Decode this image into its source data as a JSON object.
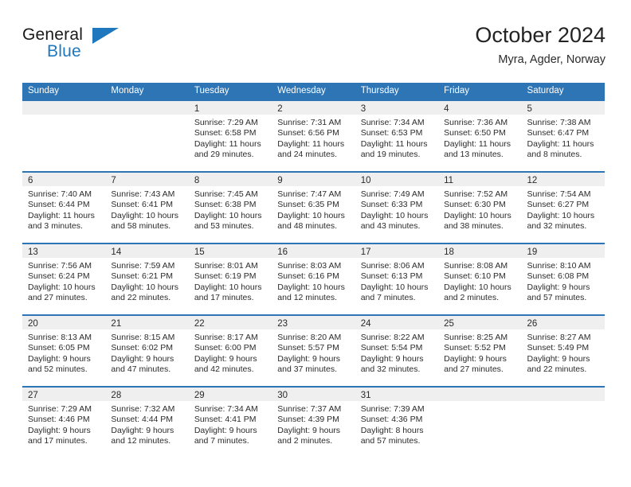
{
  "brand": {
    "word_one": "General",
    "word_two": "Blue",
    "triangle_color": "#1F77BE",
    "icon": "triangle-logo-icon"
  },
  "header": {
    "title": "October 2024",
    "subtitle": "Myra, Agder, Norway"
  },
  "theme": {
    "header_blue": "#2E75B6",
    "band_gray": "#EFEFEF",
    "text": "#2B2B2B",
    "brand_blue": "#1F77BE"
  },
  "weekdays": [
    "Sunday",
    "Monday",
    "Tuesday",
    "Wednesday",
    "Thursday",
    "Friday",
    "Saturday"
  ],
  "weeks": [
    [
      {
        "day": "",
        "empty": true,
        "sunrise": "",
        "sunset": "",
        "daylight_line1": "",
        "daylight_line2": ""
      },
      {
        "day": "",
        "empty": true,
        "sunrise": "",
        "sunset": "",
        "daylight_line1": "",
        "daylight_line2": ""
      },
      {
        "day": "1",
        "empty": false,
        "sunrise": "Sunrise: 7:29 AM",
        "sunset": "Sunset: 6:58 PM",
        "daylight_line1": "Daylight: 11 hours",
        "daylight_line2": "and 29 minutes."
      },
      {
        "day": "2",
        "empty": false,
        "sunrise": "Sunrise: 7:31 AM",
        "sunset": "Sunset: 6:56 PM",
        "daylight_line1": "Daylight: 11 hours",
        "daylight_line2": "and 24 minutes."
      },
      {
        "day": "3",
        "empty": false,
        "sunrise": "Sunrise: 7:34 AM",
        "sunset": "Sunset: 6:53 PM",
        "daylight_line1": "Daylight: 11 hours",
        "daylight_line2": "and 19 minutes."
      },
      {
        "day": "4",
        "empty": false,
        "sunrise": "Sunrise: 7:36 AM",
        "sunset": "Sunset: 6:50 PM",
        "daylight_line1": "Daylight: 11 hours",
        "daylight_line2": "and 13 minutes."
      },
      {
        "day": "5",
        "empty": false,
        "sunrise": "Sunrise: 7:38 AM",
        "sunset": "Sunset: 6:47 PM",
        "daylight_line1": "Daylight: 11 hours",
        "daylight_line2": "and 8 minutes."
      }
    ],
    [
      {
        "day": "6",
        "empty": false,
        "sunrise": "Sunrise: 7:40 AM",
        "sunset": "Sunset: 6:44 PM",
        "daylight_line1": "Daylight: 11 hours",
        "daylight_line2": "and 3 minutes."
      },
      {
        "day": "7",
        "empty": false,
        "sunrise": "Sunrise: 7:43 AM",
        "sunset": "Sunset: 6:41 PM",
        "daylight_line1": "Daylight: 10 hours",
        "daylight_line2": "and 58 minutes."
      },
      {
        "day": "8",
        "empty": false,
        "sunrise": "Sunrise: 7:45 AM",
        "sunset": "Sunset: 6:38 PM",
        "daylight_line1": "Daylight: 10 hours",
        "daylight_line2": "and 53 minutes."
      },
      {
        "day": "9",
        "empty": false,
        "sunrise": "Sunrise: 7:47 AM",
        "sunset": "Sunset: 6:35 PM",
        "daylight_line1": "Daylight: 10 hours",
        "daylight_line2": "and 48 minutes."
      },
      {
        "day": "10",
        "empty": false,
        "sunrise": "Sunrise: 7:49 AM",
        "sunset": "Sunset: 6:33 PM",
        "daylight_line1": "Daylight: 10 hours",
        "daylight_line2": "and 43 minutes."
      },
      {
        "day": "11",
        "empty": false,
        "sunrise": "Sunrise: 7:52 AM",
        "sunset": "Sunset: 6:30 PM",
        "daylight_line1": "Daylight: 10 hours",
        "daylight_line2": "and 38 minutes."
      },
      {
        "day": "12",
        "empty": false,
        "sunrise": "Sunrise: 7:54 AM",
        "sunset": "Sunset: 6:27 PM",
        "daylight_line1": "Daylight: 10 hours",
        "daylight_line2": "and 32 minutes."
      }
    ],
    [
      {
        "day": "13",
        "empty": false,
        "sunrise": "Sunrise: 7:56 AM",
        "sunset": "Sunset: 6:24 PM",
        "daylight_line1": "Daylight: 10 hours",
        "daylight_line2": "and 27 minutes."
      },
      {
        "day": "14",
        "empty": false,
        "sunrise": "Sunrise: 7:59 AM",
        "sunset": "Sunset: 6:21 PM",
        "daylight_line1": "Daylight: 10 hours",
        "daylight_line2": "and 22 minutes."
      },
      {
        "day": "15",
        "empty": false,
        "sunrise": "Sunrise: 8:01 AM",
        "sunset": "Sunset: 6:19 PM",
        "daylight_line1": "Daylight: 10 hours",
        "daylight_line2": "and 17 minutes."
      },
      {
        "day": "16",
        "empty": false,
        "sunrise": "Sunrise: 8:03 AM",
        "sunset": "Sunset: 6:16 PM",
        "daylight_line1": "Daylight: 10 hours",
        "daylight_line2": "and 12 minutes."
      },
      {
        "day": "17",
        "empty": false,
        "sunrise": "Sunrise: 8:06 AM",
        "sunset": "Sunset: 6:13 PM",
        "daylight_line1": "Daylight: 10 hours",
        "daylight_line2": "and 7 minutes."
      },
      {
        "day": "18",
        "empty": false,
        "sunrise": "Sunrise: 8:08 AM",
        "sunset": "Sunset: 6:10 PM",
        "daylight_line1": "Daylight: 10 hours",
        "daylight_line2": "and 2 minutes."
      },
      {
        "day": "19",
        "empty": false,
        "sunrise": "Sunrise: 8:10 AM",
        "sunset": "Sunset: 6:08 PM",
        "daylight_line1": "Daylight: 9 hours",
        "daylight_line2": "and 57 minutes."
      }
    ],
    [
      {
        "day": "20",
        "empty": false,
        "sunrise": "Sunrise: 8:13 AM",
        "sunset": "Sunset: 6:05 PM",
        "daylight_line1": "Daylight: 9 hours",
        "daylight_line2": "and 52 minutes."
      },
      {
        "day": "21",
        "empty": false,
        "sunrise": "Sunrise: 8:15 AM",
        "sunset": "Sunset: 6:02 PM",
        "daylight_line1": "Daylight: 9 hours",
        "daylight_line2": "and 47 minutes."
      },
      {
        "day": "22",
        "empty": false,
        "sunrise": "Sunrise: 8:17 AM",
        "sunset": "Sunset: 6:00 PM",
        "daylight_line1": "Daylight: 9 hours",
        "daylight_line2": "and 42 minutes."
      },
      {
        "day": "23",
        "empty": false,
        "sunrise": "Sunrise: 8:20 AM",
        "sunset": "Sunset: 5:57 PM",
        "daylight_line1": "Daylight: 9 hours",
        "daylight_line2": "and 37 minutes."
      },
      {
        "day": "24",
        "empty": false,
        "sunrise": "Sunrise: 8:22 AM",
        "sunset": "Sunset: 5:54 PM",
        "daylight_line1": "Daylight: 9 hours",
        "daylight_line2": "and 32 minutes."
      },
      {
        "day": "25",
        "empty": false,
        "sunrise": "Sunrise: 8:25 AM",
        "sunset": "Sunset: 5:52 PM",
        "daylight_line1": "Daylight: 9 hours",
        "daylight_line2": "and 27 minutes."
      },
      {
        "day": "26",
        "empty": false,
        "sunrise": "Sunrise: 8:27 AM",
        "sunset": "Sunset: 5:49 PM",
        "daylight_line1": "Daylight: 9 hours",
        "daylight_line2": "and 22 minutes."
      }
    ],
    [
      {
        "day": "27",
        "empty": false,
        "sunrise": "Sunrise: 7:29 AM",
        "sunset": "Sunset: 4:46 PM",
        "daylight_line1": "Daylight: 9 hours",
        "daylight_line2": "and 17 minutes."
      },
      {
        "day": "28",
        "empty": false,
        "sunrise": "Sunrise: 7:32 AM",
        "sunset": "Sunset: 4:44 PM",
        "daylight_line1": "Daylight: 9 hours",
        "daylight_line2": "and 12 minutes."
      },
      {
        "day": "29",
        "empty": false,
        "sunrise": "Sunrise: 7:34 AM",
        "sunset": "Sunset: 4:41 PM",
        "daylight_line1": "Daylight: 9 hours",
        "daylight_line2": "and 7 minutes."
      },
      {
        "day": "30",
        "empty": false,
        "sunrise": "Sunrise: 7:37 AM",
        "sunset": "Sunset: 4:39 PM",
        "daylight_line1": "Daylight: 9 hours",
        "daylight_line2": "and 2 minutes."
      },
      {
        "day": "31",
        "empty": false,
        "sunrise": "Sunrise: 7:39 AM",
        "sunset": "Sunset: 4:36 PM",
        "daylight_line1": "Daylight: 8 hours",
        "daylight_line2": "and 57 minutes."
      },
      {
        "day": "",
        "empty": true,
        "sunrise": "",
        "sunset": "",
        "daylight_line1": "",
        "daylight_line2": ""
      },
      {
        "day": "",
        "empty": true,
        "sunrise": "",
        "sunset": "",
        "daylight_line1": "",
        "daylight_line2": ""
      }
    ]
  ]
}
